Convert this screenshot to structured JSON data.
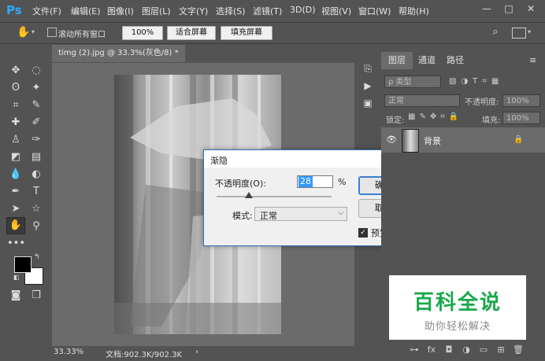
{
  "app": {
    "logo": "Ps",
    "menu": [
      "文件(F)",
      "编辑(E)",
      "图像(I)",
      "图层(L)",
      "文字(Y)",
      "选择(S)",
      "滤镜(T)",
      "3D(D)",
      "视图(V)",
      "窗口(W)",
      "帮助(H)"
    ],
    "window_controls": {
      "minimize": "—",
      "maximize": "□",
      "close": "✕"
    }
  },
  "options": {
    "scroll_all_label": "滚动所有窗口",
    "zoom_100": "100%",
    "fit_screen": "适合屏幕",
    "fill_screen": "填充屏幕"
  },
  "document": {
    "tab_title": "timg (2).jpg @ 33.3%(灰色/8) *",
    "tab_close": "×",
    "zoom": "33.33%",
    "doc_info": "文档:902.3K/902.3K",
    "arrow": "›"
  },
  "dialog": {
    "title": "渐隐",
    "opacity_label": "不透明度(O):",
    "opacity_value": "28",
    "percent": "%",
    "slider_value": 28,
    "mode_label": "模式:",
    "mode_value": "正常",
    "ok_label": "确定",
    "cancel_label": "取消",
    "preview_label": "预览(P)",
    "preview_checked": true
  },
  "layers_panel": {
    "tabs": [
      "图层",
      "通道",
      "路径"
    ],
    "filter_label": "ρ 类型",
    "blend_mode": "正常",
    "opacity_label": "不透明度:",
    "opacity_value": "100%",
    "lock_label": "锁定:",
    "fill_label": "填充:",
    "fill_value": "100%",
    "layer_name": "背景"
  },
  "watermark": {
    "title": "百科全说",
    "subtitle": "助你轻松解决"
  },
  "colors": {
    "accent": "#31a8ff",
    "watermark_green": "#1aa84b",
    "dialog_border": "#2e6fb7",
    "ok_border": "#3c7fd1"
  }
}
